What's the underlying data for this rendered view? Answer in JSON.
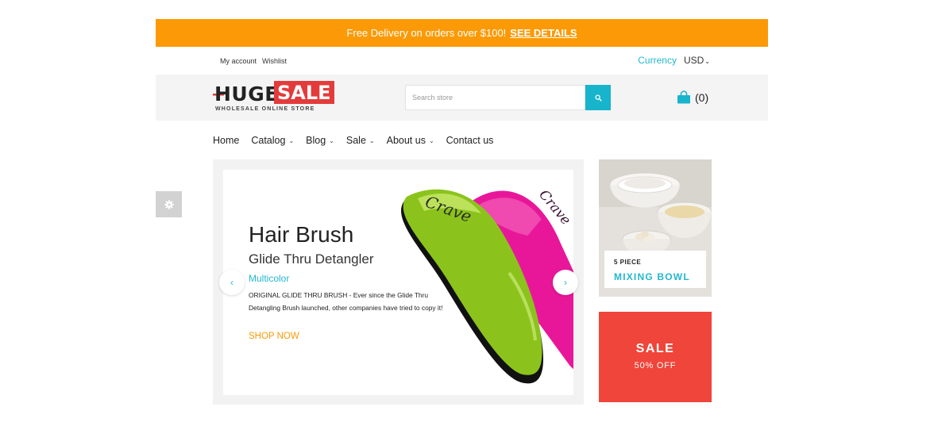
{
  "promo": {
    "text": "Free Delivery on orders over $100!",
    "link": "SEE DETAILS"
  },
  "top_links": {
    "account": "My account",
    "wishlist": "Wishlist"
  },
  "currency": {
    "label": "Currency",
    "value": "USD"
  },
  "logo": {
    "huge": "HUGE",
    "sale": "SALE",
    "tagline": "WHOLESALE ONLINE STORE"
  },
  "search": {
    "placeholder": "Search store"
  },
  "cart": {
    "count": "(0)"
  },
  "nav": {
    "items": [
      {
        "label": "Home",
        "dropdown": false
      },
      {
        "label": "Catalog",
        "dropdown": true
      },
      {
        "label": "Blog",
        "dropdown": true
      },
      {
        "label": "Sale",
        "dropdown": true
      },
      {
        "label": "About us",
        "dropdown": true
      },
      {
        "label": "Contact us",
        "dropdown": false
      }
    ]
  },
  "slider": {
    "title": "Hair Brush",
    "subtitle": "Glide Thru Detangler",
    "color": "Multicolor",
    "description": "ORIGINAL GLIDE THRU BRUSH - Ever since the Glide Thru Detangling Brush launched, other companies have tried to copy it!",
    "cta": "SHOP NOW"
  },
  "side_promos": {
    "bowl": {
      "small": "5 PIECE",
      "big": "MIXING BOWL"
    },
    "sale": {
      "title": "SALE",
      "subtitle": "50% OFF"
    }
  },
  "colors": {
    "accent": "#22b8cf",
    "promo_bar": "#fb9a06",
    "sale": "#f0453a",
    "logo_red": "#e33b3b"
  },
  "icons": [
    "gear-icon",
    "search-icon",
    "shopping-bag-icon",
    "chevron-left-icon",
    "chevron-right-icon",
    "chevron-down-icon"
  ]
}
